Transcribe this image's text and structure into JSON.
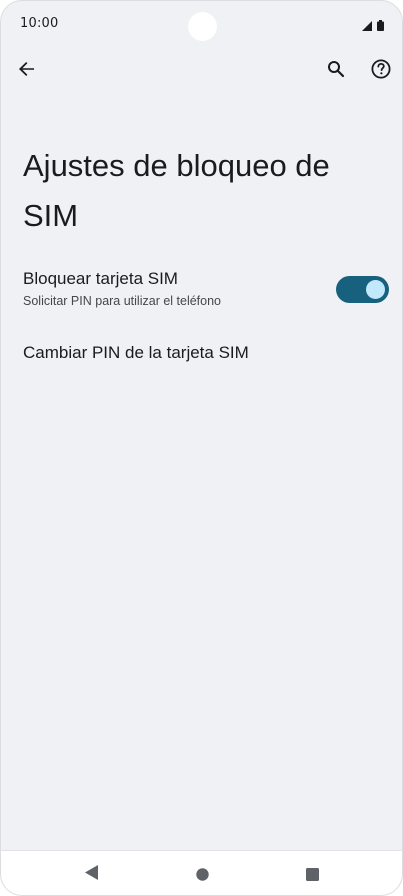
{
  "status_bar": {
    "time": "10:00",
    "icons": [
      "signal-icon",
      "battery-icon"
    ]
  },
  "app_bar": {
    "back_icon": "arrow-back-icon",
    "search_icon": "search-icon",
    "help_icon": "help-circle-icon"
  },
  "page": {
    "title": "Ajustes de bloqueo de SIM"
  },
  "settings": {
    "lock_sim": {
      "title": "Bloquear tarjeta SIM",
      "subtitle": "Solicitar PIN para utilizar el teléfono",
      "enabled": true
    },
    "change_pin": {
      "title": "Cambiar PIN de la tarjeta SIM"
    }
  },
  "colors": {
    "background": "#f0f1f4",
    "toggle_track_on": "#17617f",
    "toggle_knob_on": "#c2e8fb",
    "text_primary": "#1b1b1f",
    "text_secondary": "#44474e"
  },
  "nav_bar": {
    "icons": [
      "nav-back-icon",
      "nav-home-icon",
      "nav-recents-icon"
    ]
  }
}
